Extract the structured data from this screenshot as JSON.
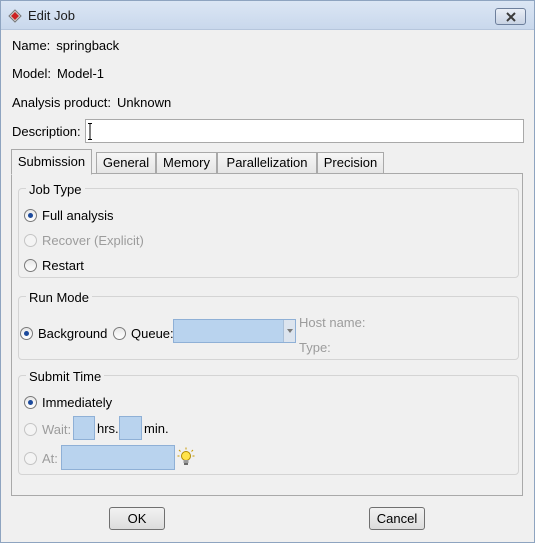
{
  "window": {
    "title": "Edit Job",
    "close_icon": "close-icon"
  },
  "info": {
    "name_label": "Name:",
    "name_value": "springback",
    "model_label": "Model:",
    "model_value": "Model-1",
    "product_label": "Analysis product:",
    "product_value": "Unknown",
    "description_label": "Description:",
    "description_value": ""
  },
  "tabs": [
    {
      "label": "Submission",
      "active": true
    },
    {
      "label": "General",
      "active": false
    },
    {
      "label": "Memory",
      "active": false
    },
    {
      "label": "Parallelization",
      "active": false
    },
    {
      "label": "Precision",
      "active": false
    }
  ],
  "job_type": {
    "title": "Job Type",
    "options": [
      {
        "label": "Full analysis",
        "checked": true,
        "enabled": true
      },
      {
        "label": "Recover (Explicit)",
        "checked": false,
        "enabled": false
      },
      {
        "label": "Restart",
        "checked": false,
        "enabled": true
      }
    ]
  },
  "run_mode": {
    "title": "Run Mode",
    "background_label": "Background",
    "background_checked": true,
    "queue_label": "Queue:",
    "queue_value": "",
    "host_name_label": "Host name:",
    "type_label": "Type:"
  },
  "submit_time": {
    "title": "Submit Time",
    "immediately_label": "Immediately",
    "immediately_checked": true,
    "wait_label": "Wait:",
    "hrs_label": "hrs.",
    "min_label": "min.",
    "hrs_value": "",
    "min_value": "",
    "at_label": "At:",
    "at_value": "",
    "bulb_icon": "lightbulb-icon"
  },
  "buttons": {
    "ok": "OK",
    "cancel": "Cancel"
  },
  "colors": {
    "field_blue": "#b9d3ee",
    "radio_dot": "#1c4a9c",
    "disabled_text": "#9c9c9c"
  }
}
